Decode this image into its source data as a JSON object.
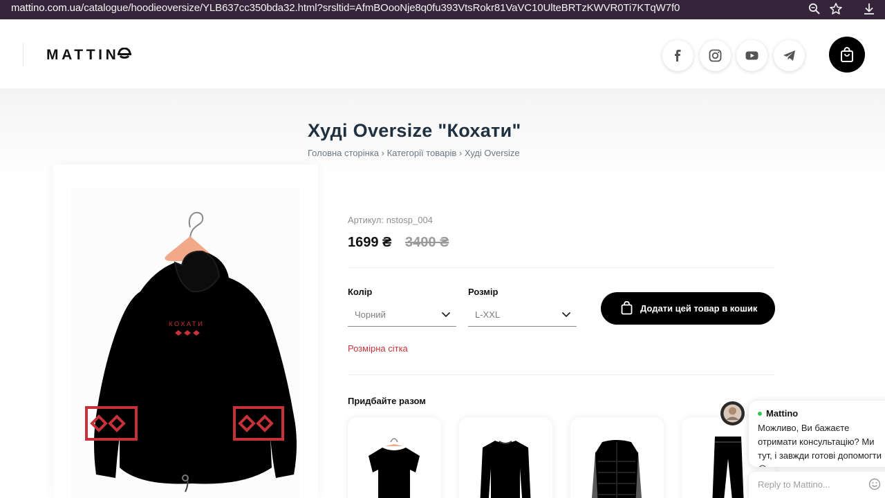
{
  "browser": {
    "url_domain": "mattino.com.ua",
    "url_path": "/catalogue/hoodieoversize/YLB637cc350bda32.html?srsltid=AfmBOooNje8q0fu393VtsRokr81VaVC10UlteBRTzKWVR0Ti7KTqW7f0",
    "icons": [
      "zoom-icon",
      "star-icon",
      "download-icon"
    ]
  },
  "header": {
    "logo": "MATTIN",
    "social_icons": [
      "facebook-icon",
      "instagram-icon",
      "youtube-icon",
      "telegram-icon"
    ],
    "cart_icon": "shopping-bag-icon"
  },
  "product": {
    "title": "Худі Oversize \"Кохати\"",
    "breadcrumb": [
      "Головна сторінка",
      "Категорії товарів",
      "Худі Oversize"
    ],
    "breadcrumb_sep": " › ",
    "print_text": "КОХАТИ",
    "sku": "Артикул: nstosp_004",
    "price": "1699 ₴",
    "old_price": "3400 ₴",
    "color_label": "Колір",
    "color_value": "Чорний",
    "size_label": "Розмір",
    "size_value": "L-XXL",
    "add_to_cart": "Додати цей товар в кошик",
    "size_chart": "Розмірна сітка",
    "buy_together": "Придбайте разом"
  },
  "related": [
    {
      "name": "t-shirt"
    },
    {
      "name": "longsleeve"
    },
    {
      "name": "puffer-vest"
    },
    {
      "name": "trousers"
    }
  ],
  "chat": {
    "name": "Mattino",
    "message": "Можливо, Ви бажаєте отримати консультацію? Ми тут, і завжди готові допомогти😌",
    "placeholder": "Reply to Mattino..."
  },
  "colors": {
    "accent_red": "#c7323a",
    "title": "#1f3040",
    "addressbar": "#35243a"
  }
}
